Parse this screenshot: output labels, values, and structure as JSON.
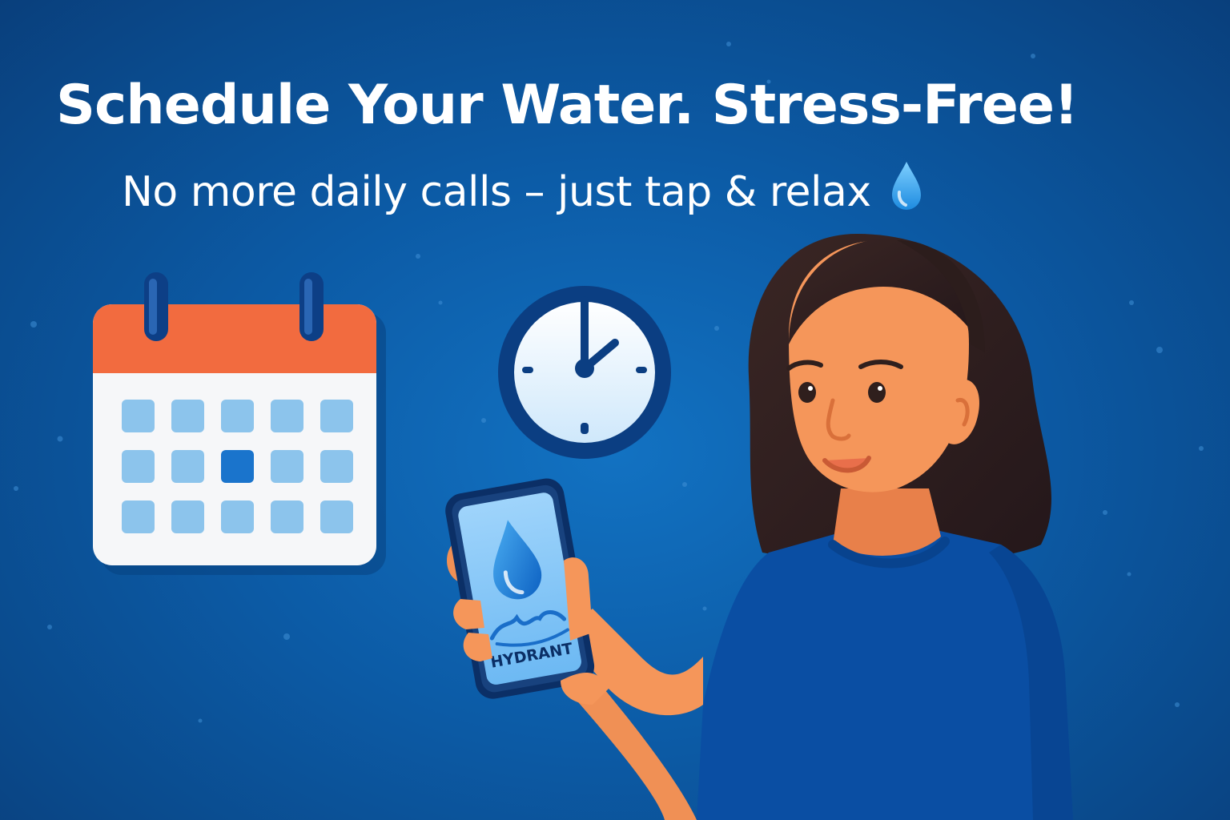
{
  "banner": {
    "headline": "Schedule Your Water. Stress-Free!",
    "subheadline": "No more daily calls – just tap & relax"
  },
  "phone": {
    "app_name": "HYDRANT"
  },
  "calendar": {
    "highlighted_cell": [
      1,
      2
    ]
  },
  "colors": {
    "background": "#0c5ba6",
    "calendar_header": "#f26b3f",
    "calendar_cell": "#8cc4ec",
    "calendar_cell_active": "#1a74cc",
    "shirt": "#0a4ea3",
    "skin": "#f5965a",
    "hair": "#2f1f1d"
  },
  "icons": {
    "subheadline_icon": "water-drop-icon",
    "calendar": "calendar-icon",
    "clock": "clock-icon",
    "phone_logo": "water-drop-icon"
  }
}
